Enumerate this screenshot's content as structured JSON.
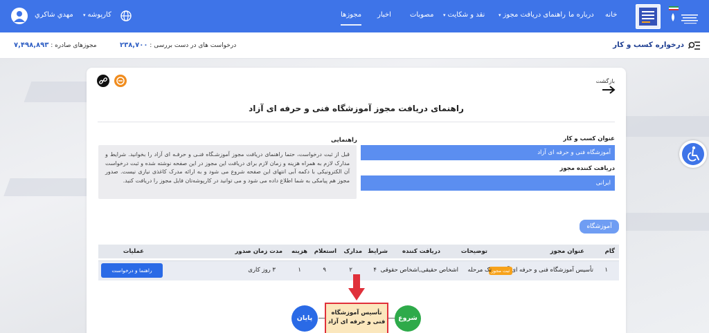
{
  "nav": {
    "items": [
      "خانه",
      "درباره ما",
      "راهنمای دریافت مجوز",
      "نقد و شکایت",
      "مصوبات",
      "اخبار",
      "مجوزها"
    ],
    "active": "مجوزها",
    "workbench": "کارپوشه",
    "user_name": "مهدي شاكري"
  },
  "subheader": {
    "title": "درخواره کسب و کار",
    "issued_label": "مجوزهای صادره :",
    "issued_count": "۷,۴۹۸,۸۹۳",
    "pending_label": "درخواست های در دست بررسی :",
    "pending_count": "۲۳۸,۷۰۰"
  },
  "card": {
    "back_label": "بازگشت",
    "title": "راهنمای دریافت مجوز آموزشگاه فنی و حرفه ای آزاد",
    "business_title_label": "عنوان کسب و کار",
    "business_title_value": "آموزشگاه فنی و حرفه ای آزاد",
    "recipient_label": "دریافت کننده مجوز",
    "recipient_value": "ایرانی",
    "guide_label": "راهنمایی",
    "guide_text": "قبل از ثبت درخواست، حتما راهنمای دریافت مجوز آموزشـگاه فنـی و حرفـه ای آزاد را بخوانید. شرایط و مدارک لازم به همراه هزینه و زمان لازم برای دریافت این مجوز در این صفحه نوشته شده و ثبت درخواست آن الکترونیکی با دکمه آبی انتهای این صفحه شروع می شود و به ارائه مدرک کاغذی نیازی نیست. صدور مجوز هم پیامکی به شما اطلاع داده می شود و می توانید در کارپوشه‌تان فایل مجوز را دریافت کنید.",
    "section_tag": "آموزشگاه"
  },
  "table": {
    "headers": {
      "step": "گام",
      "permit_title": "عنوان مجوز",
      "description": "توضیحات",
      "recipient": "دریافت کننده",
      "conditions": "شرایط",
      "documents": "مدارک",
      "inquiry": "استعلام",
      "cost": "هزینه",
      "duration": "مدت زمان صدور",
      "actions": "عملیات"
    },
    "row": {
      "step": "۱",
      "permit_title": "تأسیس آموزشگاه فنی و حرفه ای آزاد",
      "badge": "ثبت مجوز",
      "description": "تک مرحله",
      "recipient": "اشخاص حقیقی,اشخاص حقوقی",
      "conditions": "۴",
      "documents": "۲",
      "inquiry": "۹",
      "cost": "۱",
      "duration": "۳ روز کاری",
      "action_label": "راهنما و درخواست"
    }
  },
  "flow": {
    "start": "شروع",
    "step": "تأسیس آموزشگاه فنی و حرفه ای آزاد",
    "end": "پایان"
  },
  "colors": {
    "primary": "#3e74e8",
    "field": "#5b8ef0",
    "badge": "#f7a21b",
    "start": "#2eaa4a",
    "end": "#2a6ae6",
    "highlight": "#e0303a"
  }
}
